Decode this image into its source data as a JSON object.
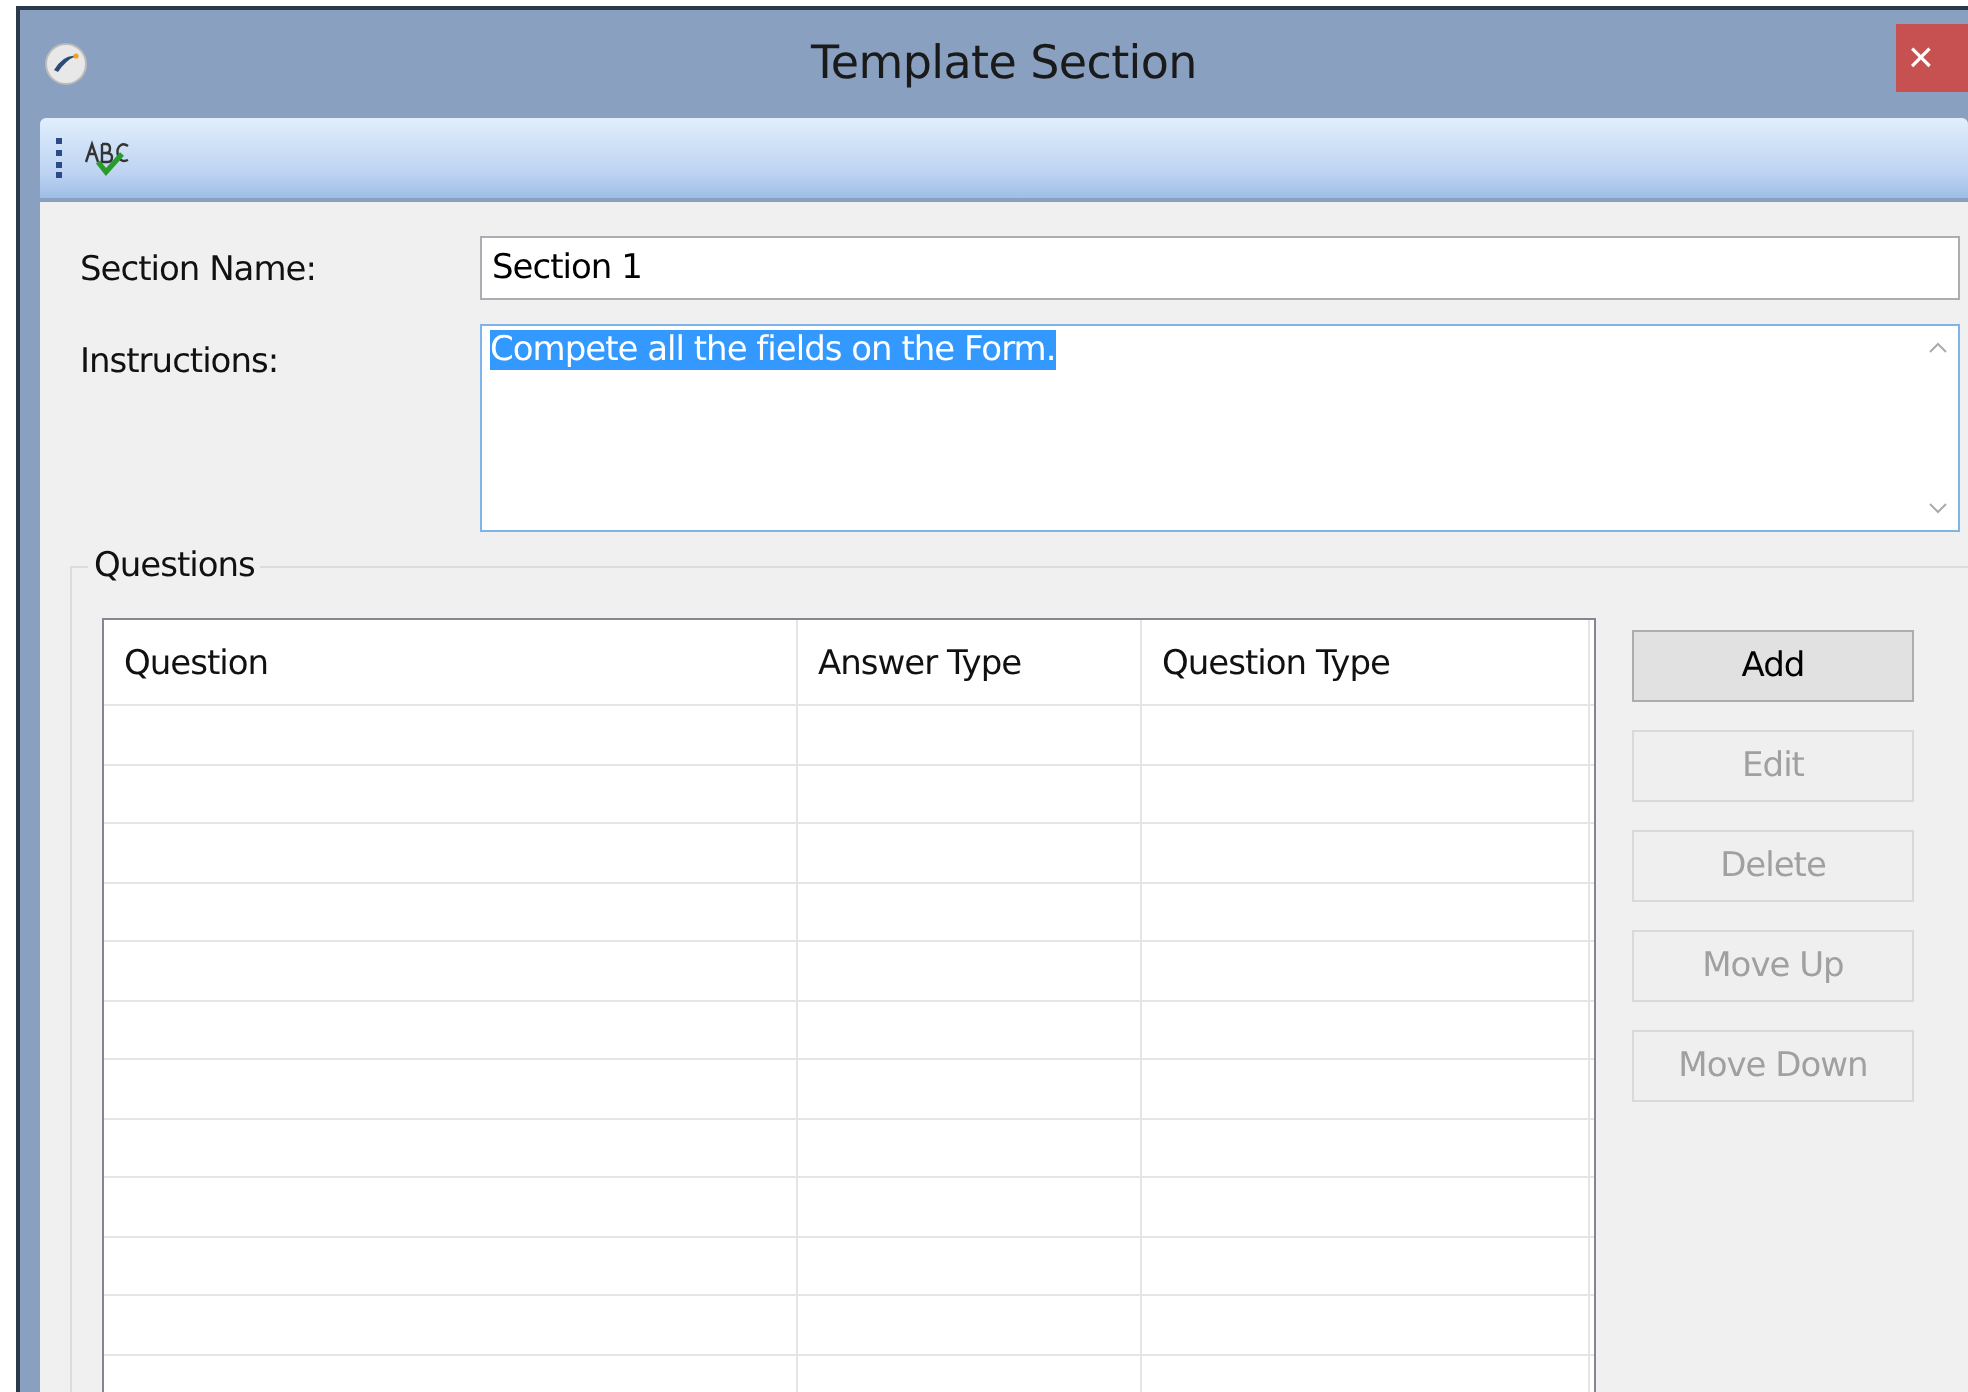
{
  "window": {
    "title": "Template Section",
    "close": "×"
  },
  "form": {
    "section_name": {
      "label": "Section Name:",
      "value": "Section 1"
    },
    "instructions": {
      "label": "Instructions:",
      "value": "Compete all the fields on the Form.",
      "text_selected": true
    }
  },
  "questions": {
    "legend": "Questions",
    "table": {
      "columns": [
        "Question",
        "Answer Type",
        "Question Type"
      ]
    },
    "buttons": [
      {
        "label": "Add",
        "disabled": false
      },
      {
        "label": "Edit",
        "disabled": true
      },
      {
        "label": "Delete",
        "disabled": true
      },
      {
        "label": "Move Up",
        "disabled": true
      },
      {
        "label": "Move Down",
        "disabled": true
      }
    ]
  }
}
